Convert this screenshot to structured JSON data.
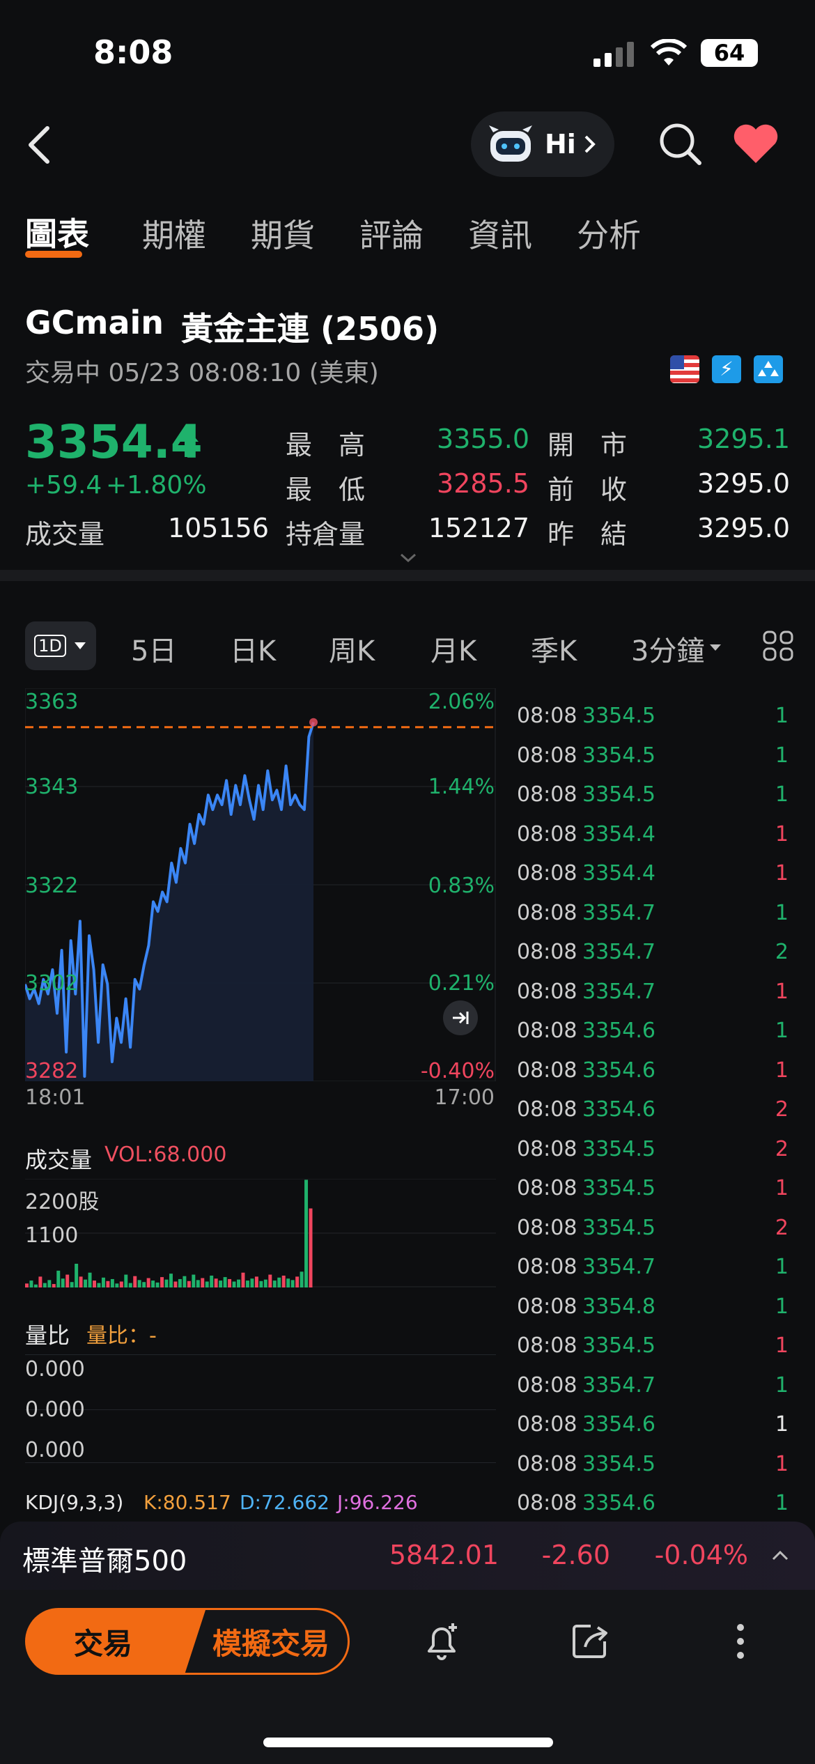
{
  "status_bar": {
    "time": "8:08",
    "battery": "64"
  },
  "nav": {
    "assistant_label": "Hi"
  },
  "tabs": [
    {
      "label": "圖表",
      "active": true
    },
    {
      "label": "期權",
      "active": false
    },
    {
      "label": "期貨",
      "active": false
    },
    {
      "label": "評論",
      "active": false
    },
    {
      "label": "資訊",
      "active": false
    },
    {
      "label": "分析",
      "active": false
    }
  ],
  "instrument": {
    "symbol": "GCmain",
    "name": "黃金主連 (2506)",
    "status": "交易中 05/23 08:08:10 (美東)",
    "price": "3354.4",
    "change": "+59.4",
    "change_pct": "+1.80%"
  },
  "stats": {
    "high_label": "最　高",
    "high": "3355.0",
    "low_label": "最　低",
    "low": "3285.5",
    "open_label": "開　市",
    "open": "3295.1",
    "prev_close_label": "前　收",
    "prev_close": "3295.0",
    "settle_label": "昨　結",
    "settle": "3295.0",
    "volume_label": "成交量",
    "volume": "105156",
    "oi_label": "持倉量",
    "oi": "152127"
  },
  "periods": {
    "selected": "1D",
    "items": [
      "5日",
      "日K",
      "周K",
      "月K",
      "季K"
    ],
    "interval": "3分鐘"
  },
  "chart_data": {
    "type": "line",
    "title": "",
    "x_start_label": "18:01",
    "x_end_label": "17:00",
    "y_ticks": [
      "3363",
      "3343",
      "3322",
      "3302",
      "3282"
    ],
    "pct_ticks": [
      "2.06%",
      "1.44%",
      "0.83%",
      "0.21%",
      "-0.40%"
    ],
    "ylim": [
      3282,
      3363
    ],
    "current_price_line": 3355.0,
    "series": [
      {
        "values": [
          3302,
          3299,
          3301,
          3298,
          3303,
          3300,
          3305,
          3296,
          3309,
          3288,
          3311,
          3300,
          3315,
          3283,
          3312,
          3305,
          3290,
          3306,
          3302,
          3286,
          3295,
          3290,
          3299,
          3289,
          3303,
          3301,
          3306,
          3310,
          3319,
          3317,
          3321,
          3319,
          3327,
          3323,
          3330,
          3327,
          3335,
          3331,
          3337,
          3335,
          3341,
          3338,
          3341,
          3339,
          3344,
          3337,
          3343,
          3339,
          3345,
          3340,
          3336,
          3343,
          3338,
          3346,
          3340,
          3342,
          3338,
          3347,
          3339,
          3341,
          3339,
          3338,
          3353,
          3356
        ]
      }
    ]
  },
  "volume": {
    "label": "成交量",
    "vol_label": "VOL:68.000",
    "ticks": [
      "2200股",
      "1100"
    ],
    "values": [
      80,
      140,
      60,
      220,
      90,
      150,
      70,
      340,
      180,
      260,
      110,
      480,
      220,
      160,
      300,
      140,
      90,
      200,
      130,
      170,
      80,
      120,
      260,
      90,
      230,
      150,
      110,
      190,
      140,
      100,
      210,
      160,
      280,
      120,
      170,
      230,
      130,
      260,
      150,
      190,
      120,
      240,
      180,
      140,
      210,
      170,
      120,
      160,
      300,
      140,
      180,
      220,
      130,
      160,
      260,
      140,
      200,
      240,
      180,
      150,
      220,
      320,
      2180,
      1600
    ]
  },
  "ratio": {
    "label": "量比",
    "value_label": "量比：-",
    "ticks": [
      "0.000",
      "0.000",
      "0.000"
    ]
  },
  "kdj": {
    "label": "KDJ(9,3,3)",
    "k": "K:80.517",
    "d": "D:72.662",
    "j": "J:96.226"
  },
  "trades": [
    {
      "time": "08:08",
      "price": "3354.5",
      "qty": "1",
      "dir": "green"
    },
    {
      "time": "08:08",
      "price": "3354.5",
      "qty": "1",
      "dir": "green"
    },
    {
      "time": "08:08",
      "price": "3354.5",
      "qty": "1",
      "dir": "green"
    },
    {
      "time": "08:08",
      "price": "3354.4",
      "qty": "1",
      "dir": "red"
    },
    {
      "time": "08:08",
      "price": "3354.4",
      "qty": "1",
      "dir": "red"
    },
    {
      "time": "08:08",
      "price": "3354.7",
      "qty": "1",
      "dir": "green"
    },
    {
      "time": "08:08",
      "price": "3354.7",
      "qty": "2",
      "dir": "green"
    },
    {
      "time": "08:08",
      "price": "3354.7",
      "qty": "1",
      "dir": "red"
    },
    {
      "time": "08:08",
      "price": "3354.6",
      "qty": "1",
      "dir": "green"
    },
    {
      "time": "08:08",
      "price": "3354.6",
      "qty": "1",
      "dir": "red"
    },
    {
      "time": "08:08",
      "price": "3354.6",
      "qty": "2",
      "dir": "red"
    },
    {
      "time": "08:08",
      "price": "3354.5",
      "qty": "2",
      "dir": "red"
    },
    {
      "time": "08:08",
      "price": "3354.5",
      "qty": "1",
      "dir": "red"
    },
    {
      "time": "08:08",
      "price": "3354.5",
      "qty": "2",
      "dir": "red"
    },
    {
      "time": "08:08",
      "price": "3354.7",
      "qty": "1",
      "dir": "green"
    },
    {
      "time": "08:08",
      "price": "3354.8",
      "qty": "1",
      "dir": "green"
    },
    {
      "time": "08:08",
      "price": "3354.5",
      "qty": "1",
      "dir": "red"
    },
    {
      "time": "08:08",
      "price": "3354.7",
      "qty": "1",
      "dir": "green"
    },
    {
      "time": "08:08",
      "price": "3354.6",
      "qty": "1",
      "dir": "white"
    },
    {
      "time": "08:08",
      "price": "3354.5",
      "qty": "1",
      "dir": "red"
    },
    {
      "time": "08:08",
      "price": "3354.6",
      "qty": "1",
      "dir": "green"
    }
  ],
  "index_ticker": {
    "name": "標準普爾500",
    "price": "5842.01",
    "change": "-2.60",
    "pct": "-0.04%"
  },
  "bottom": {
    "trade": "交易",
    "paper_trade": "模擬交易"
  },
  "colors": {
    "up": "#1fb26c",
    "down": "#f0455e",
    "accent": "#f26a13",
    "line": "#3b86f5"
  }
}
